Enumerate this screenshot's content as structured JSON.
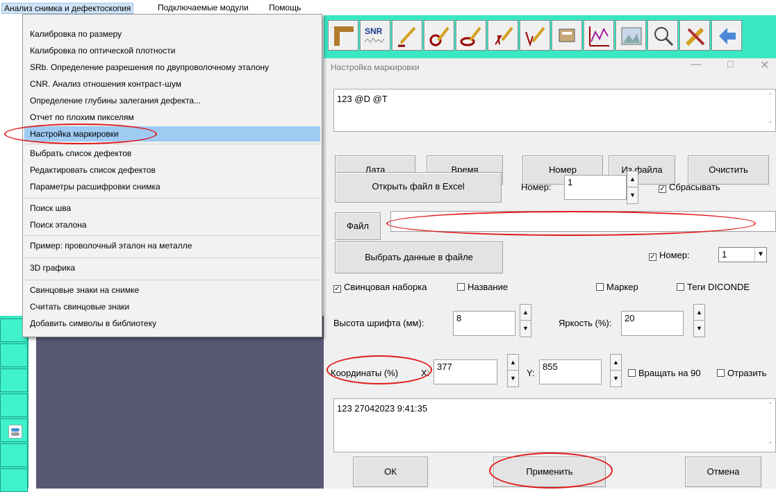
{
  "menubar": {
    "items": [
      "Анализ снимка и дефектоскопия",
      "Подключаемые модули",
      "Помощь"
    ]
  },
  "dropdown": {
    "items": [
      "Калибровка по размеру",
      "Калибровка по оптической плотности",
      "SRb. Определение разрешения по двупроволочному эталону",
      "CNR. Анализ отношения контраст-шум",
      "Определение глубины залегания дефекта...",
      "Отчет по плохим пикселям",
      "Настройка маркировки",
      "Выбрать список дефектов",
      "Редактировать список дефектов",
      "Параметры расшифровки снимка",
      "Поиск шва",
      "Поиск эталона",
      "Пример: проволочный эталон на металле",
      "3D графика",
      "Свинцовые знаки на снимке",
      "Считать свинцовые знаки",
      "Добавить символы в библиотеку"
    ],
    "selected": "Настройка маркировки"
  },
  "toolbar": {
    "snr_label": "SNR",
    "icons": [
      "ruler-icon",
      "snr-icon",
      "pencil-line-icon",
      "pencil-circle-icon",
      "pencil-ellipse-icon",
      "pencil-arrow-icon",
      "pencil-v-icon",
      "hand-pointer-icon",
      "chart-icon",
      "image-icon",
      "magnifier-icon",
      "eraser-icon",
      "arrow-icon"
    ]
  },
  "dialog": {
    "title": "Настройка маркировки",
    "template_text": "123 @D @T",
    "buttons": {
      "date": "Дата",
      "time": "Время",
      "number": "Номер",
      "from_file": "Из файла",
      "clear": "Очистить",
      "open_excel": "Открыть файл в Excel",
      "file": "Файл",
      "select_data": "Выбрать данные в файле",
      "ok": "ОК",
      "apply": "Применить",
      "cancel": "Отмена"
    },
    "number_label": "Номер:",
    "number_value": "1",
    "reset_label": "Сбрасывать",
    "file_path": "",
    "number2_label": "Номер:",
    "number2_value": "1",
    "checks": {
      "lead": "Свинцовая наборка",
      "name": "Название",
      "marker": "Маркер",
      "dicom": "Теги DICONDE"
    },
    "font_height_label": "Высота шрифта (мм):",
    "font_height_value": "8",
    "brightness_label": "Яркость (%):",
    "brightness_value": "20",
    "coords_label": "Координаты (%)",
    "x_label": "X:",
    "x_value": "377",
    "y_label": "Y:",
    "y_value": "855",
    "rotate_label": "Вращать на 90",
    "mirror_label": "Отразить",
    "preview_text": "123 27042023 9:41:35"
  }
}
